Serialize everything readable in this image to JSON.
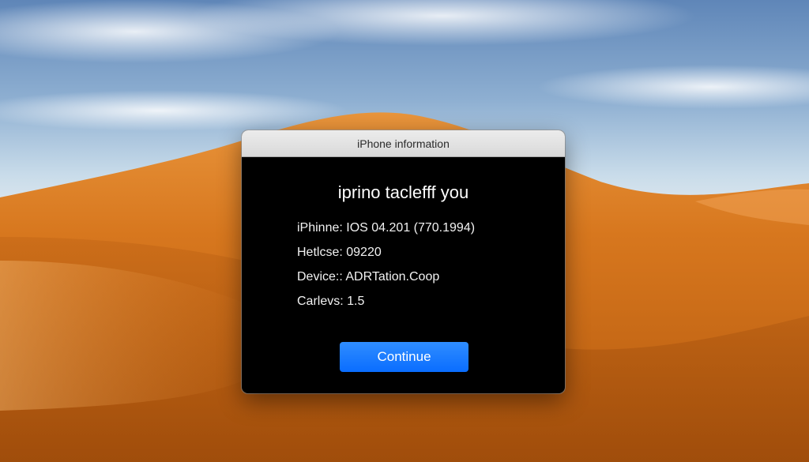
{
  "dialog": {
    "title": "iPhone information",
    "heading": "iprino taclefff you",
    "info": [
      "iPhinne: IOS 04.201 (770.1994)",
      "Hetlcse: 09220",
      "Device:: ADRTation.Coop",
      "Carlevs: 1.5"
    ],
    "continue_label": "Continue"
  },
  "colors": {
    "dialog_background": "#000000",
    "button_accent": "#0a6dff",
    "dune": "#d7771e"
  }
}
